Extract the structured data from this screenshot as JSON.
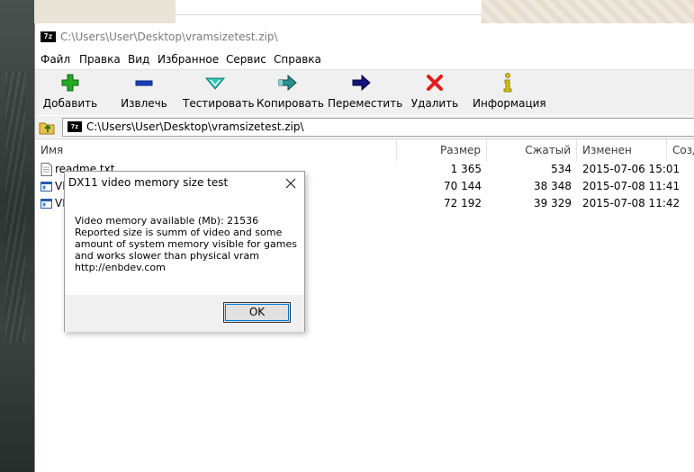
{
  "window": {
    "title": "C:\\Users\\User\\Desktop\\vramsizetest.zip\\",
    "icon_text": "7z"
  },
  "menu": [
    "Файл",
    "Правка",
    "Вид",
    "Избранное",
    "Сервис",
    "Справка"
  ],
  "toolbar": [
    {
      "label": "Добавить",
      "icon": "add-icon",
      "color": "#22aa22"
    },
    {
      "label": "Извлечь",
      "icon": "extract-icon",
      "color": "#1a3fbf"
    },
    {
      "label": "Тестировать",
      "icon": "test-icon",
      "color": "#33c3b8"
    },
    {
      "label": "Копировать",
      "icon": "copy-icon",
      "color": "#2a8f8f"
    },
    {
      "label": "Переместить",
      "icon": "move-icon",
      "color": "#14147a"
    },
    {
      "label": "Удалить",
      "icon": "delete-icon",
      "color": "#e01b1b"
    },
    {
      "label": "Информация",
      "icon": "info-icon",
      "color": "#d8c400"
    }
  ],
  "address": {
    "path": "C:\\Users\\User\\Desktop\\vramsizetest.zip\\",
    "icon_text": "7z"
  },
  "columns": [
    "Имя",
    "Размер",
    "Сжатый",
    "Изменен",
    "Созд"
  ],
  "files": [
    {
      "name": "readme.txt",
      "size": "1 365",
      "packed": "534",
      "modified": "2015-07-06 15:01",
      "icon": "text-file-icon"
    },
    {
      "name": "VR",
      "size": "70 144",
      "packed": "38 348",
      "modified": "2015-07-08 11:41",
      "icon": "exe-file-icon"
    },
    {
      "name": "VR",
      "size": "72 192",
      "packed": "39 329",
      "modified": "2015-07-08 11:42",
      "icon": "exe-file-icon"
    }
  ],
  "dialog": {
    "title": "DX11 video memory size test",
    "lines": [
      "Video memory available (Mb): 21536",
      "Reported size is summ of video and some",
      "amount of system memory visible for games",
      "and works slower than physical vram",
      "http://enbdev.com"
    ],
    "ok_label": "OK"
  },
  "colors": {
    "accent": "#0078d7",
    "toolbar_bg": "#f0f0f0"
  }
}
